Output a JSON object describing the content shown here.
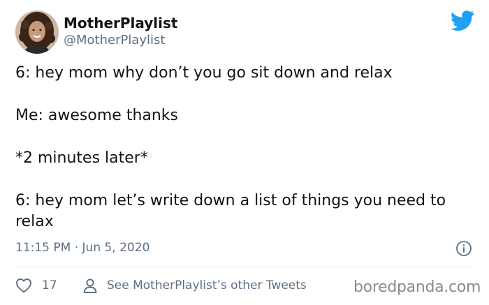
{
  "author": {
    "display_name": "MotherPlaylist",
    "handle": "@MotherPlaylist",
    "avatar_icon": "profile-photo"
  },
  "brand": {
    "icon": "twitter-bird-icon",
    "color": "#1da1f2"
  },
  "tweet": {
    "lines": [
      "6: hey mom why don’t you go sit down and relax",
      "Me: awesome thanks",
      "*2 minutes later*",
      "6: hey mom let’s write down a list of things you need to relax"
    ]
  },
  "meta": {
    "timestamp": "11:15 PM · Jun 5, 2020",
    "info_icon": "info-icon"
  },
  "actions": {
    "likes_count": "17",
    "see_other_tweets": "See MotherPlaylist’s other Tweets"
  },
  "watermark": {
    "text": "boredpanda.com"
  },
  "colors": {
    "text_primary": "#0f1419",
    "text_secondary": "#5b7083",
    "divider": "#d6dde3",
    "watermark": "#8a8a8a"
  }
}
